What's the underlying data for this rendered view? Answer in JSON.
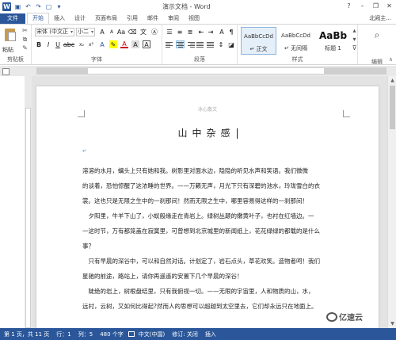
{
  "titlebar": {
    "window_title": "演示文档 - Word",
    "minimize": "–",
    "restore": "❐",
    "close": "✕",
    "help": "?"
  },
  "tabs": [
    "文件",
    "开始",
    "插入",
    "设计",
    "页面布局",
    "引用",
    "邮件",
    "审阅",
    "视图"
  ],
  "active_tab": "开始",
  "user": "北阙主...",
  "ribbon": {
    "clipboard": {
      "paste": "粘贴",
      "label": "剪贴板"
    },
    "font": {
      "family": "宋体 (中文正",
      "size": "小二",
      "bold": "B",
      "italic": "I",
      "underline": "U",
      "font_color": "A",
      "label": "字体"
    },
    "paragraph": {
      "label": "段落"
    },
    "styles": {
      "items": [
        {
          "preview": "AaBbCcDd",
          "name": "↵ 正文"
        },
        {
          "preview": "AaBbCcDd",
          "name": "↵ 无间隔"
        },
        {
          "preview": "AaBb",
          "name": "标题 1"
        }
      ],
      "label": "样式"
    },
    "editing": {
      "label": "编辑"
    }
  },
  "document": {
    "header": "冰心散文",
    "title": "山中杂感",
    "lines": [
      "溶溶的水月，螭头上只有她和我。树影里对面水边，隐隐的听见水声和笑语。我们微微",
      "的谈着，恐怕惊醒了这浓睡的世界。——万籁无声，月光下只有深碧的池水，玲珑雪白的衣",
      "裳。这也只是无限之生中的一刹那间！然而无限之生中，哪里容易得这样的一刹那间！",
      "　夕阳里，牛羊下山了，小蚁般缘走在青岩上。绿树丛颠的嫩黄叶子，也衬在红墙边。一",
      "一这时节，万有都笼盖在寂寞里，可曾想到北京城里的新闻纸上，花花绿绿的都载的是什么",
      "事？",
      "　只有早晨的深谷中，可以和自然对话。计划定了，岩石点头，草花欢笑。造物者呵！我们",
      "星驰的前途，路站上，请你再遥遥的安置下几个早晨的深谷！",
      "　陡绝的岩上，树根盘结里，只有我俯视一切。——无限的宇宙里，人和物质的山，水，",
      "远村，云树，又如何比得起?然而人的思想可以超越到太空里去，它们却永远只在地面上。"
    ]
  },
  "statusbar": {
    "page": "第 1 页，共 11 页",
    "line": "行：1",
    "column": "列：5",
    "word_count": "480 个字",
    "language": "中文(中国)",
    "track_changes": "修订: 关闭",
    "insert_mode": "插入"
  },
  "watermark": "亿速云",
  "colors": {
    "accent": "#2b579a"
  }
}
